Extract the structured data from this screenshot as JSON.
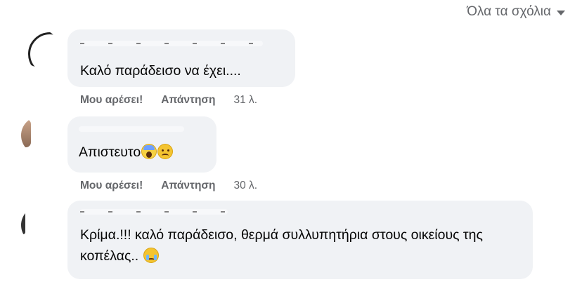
{
  "sort": {
    "label": "Όλα τα σχόλια",
    "icon": "caret-down-icon"
  },
  "comments": [
    {
      "text": "Καλό παράδεισο να έχει....",
      "emoji": [],
      "actions": {
        "like": "Μου αρέσει!",
        "reply": "Απάντηση"
      },
      "time": "31 λ."
    },
    {
      "text": "Απιστευτο",
      "emoji": [
        "face-screaming-emoji",
        "sad-face-emoji"
      ],
      "actions": {
        "like": "Μου αρέσει!",
        "reply": "Απάντηση"
      },
      "time": "30 λ."
    },
    {
      "text": "Κρίμα.!!! καλό παράδεισο, θερμά συλλυπητήρια στους οικείους της κοπέλας..",
      "emoji": [
        "crying-face-emoji"
      ]
    }
  ],
  "colors": {
    "bubble": "#f0f2f5",
    "meta": "#65676b",
    "text": "#050505"
  }
}
